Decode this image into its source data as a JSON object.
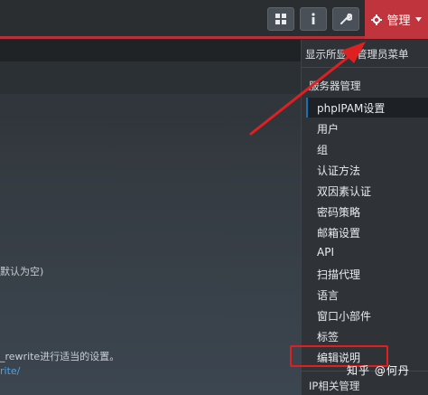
{
  "topbar": {
    "admin_label": "管理",
    "icons": [
      "grid-icon",
      "info-icon",
      "wrench-icon",
      "gear-icon"
    ]
  },
  "page": {
    "text_default": "默认为空)",
    "text_rewrite": "_rewrite进行适当的设置。",
    "link_fragment": "rite/"
  },
  "menu": {
    "show_label": "显示所",
    "show_admin_menu": "显示管理员菜单",
    "server_management_header": "服务器管理",
    "items": [
      "phpIPAM设置",
      "用户",
      "组",
      "认证方法",
      "双因素认证",
      "密码策略",
      "邮箱设置",
      "API",
      "扫描代理",
      "语言",
      "窗口小部件",
      "标签",
      "编辑说明"
    ],
    "ip_management_header": "IP相关管理"
  },
  "watermark": "知乎 @何丹",
  "colors": {
    "accent_red": "#c0343d",
    "annotation_red": "#e02020",
    "menu_bg": "#2f3338",
    "link_blue": "#4aa3e6"
  }
}
